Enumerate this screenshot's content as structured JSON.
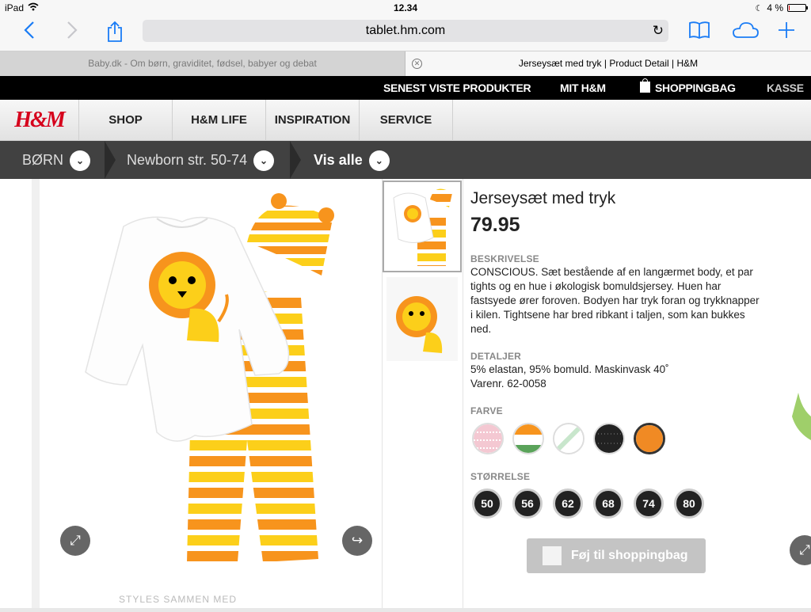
{
  "status_bar": {
    "device": "iPad",
    "time": "12.34",
    "battery": "4 %",
    "battery_level": 0.04
  },
  "browser": {
    "url": "tablet.hm.com",
    "tabs": [
      {
        "title": "Baby.dk - Om børn, graviditet, fødsel, babyer og debat",
        "active": false
      },
      {
        "title": "Jerseysæt med tryk | Product Detail | H&M",
        "active": true
      }
    ]
  },
  "topbar": {
    "recent": "SENEST VISTE PRODUKTER",
    "my_hm": "MIT H&M",
    "bag": "SHOPPINGBAG",
    "checkout": "KASSE"
  },
  "nav": {
    "logo": "H&M",
    "items": [
      "SHOP",
      "H&M LIFE",
      "INSPIRATION",
      "SERVICE"
    ]
  },
  "breadcrumb": {
    "items": [
      "BØRN",
      "Newborn str. 50-74",
      "Vis alle"
    ]
  },
  "product": {
    "title": "Jerseysæt med tryk",
    "price": "79.95",
    "description_label": "BESKRIVELSE",
    "description": "CONSCIOUS. Sæt bestående af en langærmet body, et par tights og en hue i økologisk bomuldsjersey. Huen har fastsyede ører foroven. Bodyen har tryk foran og trykknapper i kilen. Tightsene har bred ribkant i taljen, som kan bukkes ned.",
    "details_label": "DETALJER",
    "details_line1": "5% elastan, 95% bomuld. Maskinvask 40˚",
    "details_line2": "Varenr. 62-0058",
    "color_label": "FARVE",
    "colors": [
      "#f4c8d2",
      "#ffffff",
      "#c8e6cc",
      "#222222",
      "#f08a24"
    ],
    "size_label": "STØRRELSE",
    "sizes": [
      "50",
      "56",
      "62",
      "68",
      "74",
      "80"
    ],
    "add_to_bag": "Føj til shoppingbag"
  },
  "palette": {
    "orange": "#f7941d",
    "yellow": "#fccf1a",
    "hm_red": "#d6001c"
  },
  "footer_peek": "STYLES SAMMEN MED"
}
